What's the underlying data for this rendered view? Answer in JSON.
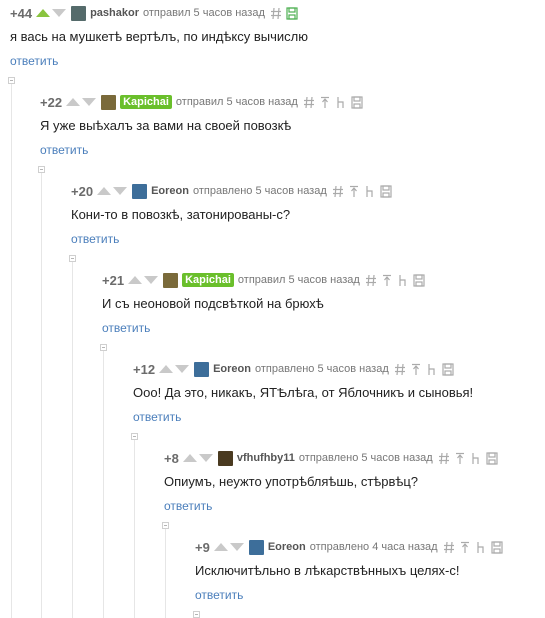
{
  "reply_label": "ответить",
  "colors": {
    "vote_active": "#8ac43f",
    "vote_inactive": "#c9c9c9",
    "author_badge": "#6abf2b",
    "reply_link": "#4a7ebb"
  },
  "comments": [
    {
      "rating": "+44",
      "author": "pashakor",
      "meta": "отправил 5 часов назад",
      "text": "я вась на мушкетѣ вертѣлъ, по индѣксу вычислю",
      "avatar_icon": "user-avatar-icon",
      "upvoted": true,
      "badge": false
    },
    {
      "rating": "+22",
      "author": "Kapichai",
      "meta": "отправил 5 часов назад",
      "text": "Я уже выѣхалъ за вами на своей повозкѣ",
      "avatar_icon": "user-avatar-icon",
      "upvoted": false,
      "badge": true
    },
    {
      "rating": "+20",
      "author": "Eoreon",
      "meta": "отправлено 5 часов назад",
      "text": "Кони-то в повозкѣ, затонированы-с?",
      "avatar_icon": "user-avatar-icon",
      "upvoted": false,
      "badge": false
    },
    {
      "rating": "+21",
      "author": "Kapichai",
      "meta": "отправил 5 часов назад",
      "text": "И съ неоновой подсвѣткой на брюхѣ",
      "avatar_icon": "user-avatar-icon",
      "upvoted": false,
      "badge": true
    },
    {
      "rating": "+12",
      "author": "Eoreon",
      "meta": "отправлено 5 часов назад",
      "text": "Ооо! Да это, никакъ, ЯТѢлѣга, от Яблочникъ и сыновья!",
      "avatar_icon": "user-avatar-icon",
      "upvoted": false,
      "badge": false
    },
    {
      "rating": "+8",
      "author": "vfhufhby11",
      "meta": "отправлено 5 часов назад",
      "text": "Опиумъ, неужто употрѣбляѣшь, стѣрвѣц?",
      "avatar_icon": "user-avatar-icon",
      "upvoted": false,
      "badge": false
    },
    {
      "rating": "+9",
      "author": "Eoreon",
      "meta": "отправлено 4 часа назад",
      "text": "Исключитѣльно в лѣкарствѣнныхъ целях-с!",
      "avatar_icon": "user-avatar-icon",
      "upvoted": false,
      "badge": false
    }
  ]
}
